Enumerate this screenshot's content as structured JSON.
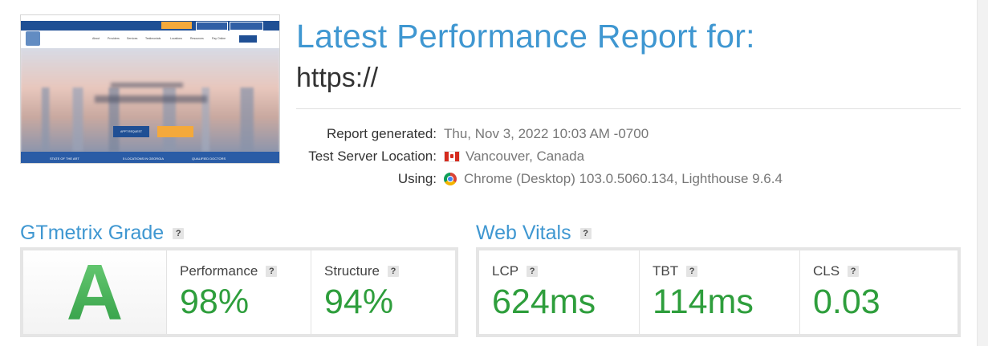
{
  "report": {
    "title": "Latest Performance Report for:",
    "url": "https://"
  },
  "thumbnail": {
    "top_pills": [
      "",
      "",
      ""
    ],
    "nav_items": [
      "About",
      "Providers",
      "Services",
      "Testimonials",
      "Locations",
      "Resources",
      "Pay Online"
    ],
    "nav_button": "CONTACT",
    "cta_primary": "APPT REQUEST",
    "cta_secondary": "",
    "footer_items": [
      "STATE OF THE ART",
      "5 LOCATIONS IN GEORGIA",
      "QUALIFIED DOCTORS"
    ]
  },
  "meta": {
    "report_generated_label": "Report generated:",
    "report_generated_value": "Thu, Nov 3, 2022 10:03 AM -0700",
    "server_location_label": "Test Server Location:",
    "server_location_value": "Vancouver, Canada",
    "server_location_icon": "canada-flag-icon",
    "using_label": "Using:",
    "using_value": "Chrome (Desktop) 103.0.5060.134, Lighthouse 9.6.4",
    "using_icon": "chrome-icon"
  },
  "grade": {
    "section_title": "GTmetrix Grade",
    "help": "?",
    "letter": "A",
    "performance_label": "Performance",
    "performance_value": "98%",
    "structure_label": "Structure",
    "structure_value": "94%"
  },
  "vitals": {
    "section_title": "Web Vitals",
    "help": "?",
    "lcp_label": "LCP",
    "lcp_value": "624ms",
    "tbt_label": "TBT",
    "tbt_value": "114ms",
    "cls_label": "CLS",
    "cls_value": "0.03"
  },
  "colors": {
    "accent_blue": "#3f97d1",
    "good_green": "#2e9e3c",
    "grade_green": "#3fae52"
  }
}
